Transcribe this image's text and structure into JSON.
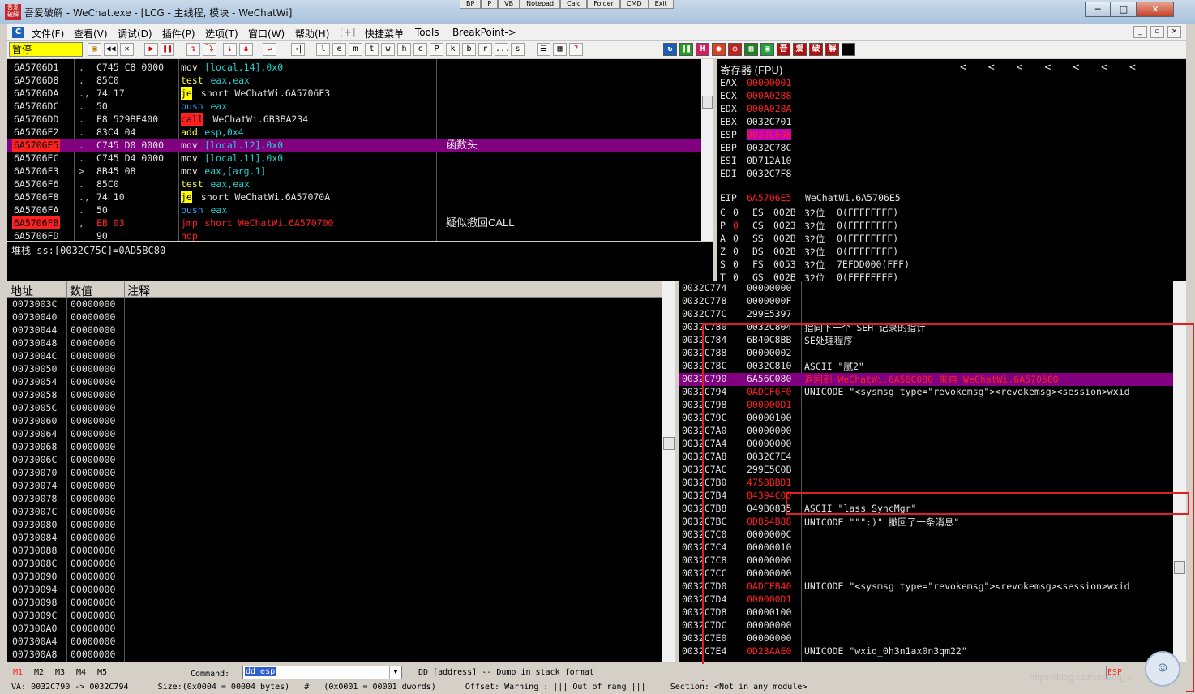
{
  "window": {
    "title": "吾爱破解 - WeChat.exe - [LCG - 主线程, 模块 - WeChatWi]",
    "app_icon_text": "吾爱破解",
    "top_buttons": [
      "BP",
      "P",
      "VB",
      "Notepad",
      "Calc",
      "Folder",
      "CMD",
      "Exit"
    ],
    "controls": {
      "minimize": "─",
      "maximize": "□",
      "close": "✕"
    }
  },
  "menu": {
    "logo": "C",
    "items": [
      "文件(F)",
      "查看(V)",
      "调试(D)",
      "插件(P)",
      "选项(T)",
      "窗口(W)",
      "帮助(H)",
      "[+]",
      "快捷菜单",
      "Tools",
      "BreakPoint->"
    ],
    "mdi": [
      "_",
      "▫",
      "×"
    ]
  },
  "toolbar": {
    "status": "暂停",
    "letters": [
      "l",
      "e",
      "m",
      "t",
      "w",
      "h",
      "c",
      "P",
      "k",
      "b",
      "r",
      "...",
      "s"
    ],
    "plugin_icons": [
      "吾",
      "爱",
      "破",
      "解"
    ]
  },
  "cpu": {
    "rows": [
      {
        "addr": "6A5706D1",
        "mark": ".",
        "hex": "C745 C8 0000",
        "mnem": "mov",
        "ops": "[local.14],0x0",
        "kind": "mov",
        "comment": ""
      },
      {
        "addr": "6A5706D8",
        "mark": ".",
        "hex": "85C0",
        "mnem": "test",
        "ops": "eax,eax",
        "kind": "test",
        "comment": ""
      },
      {
        "addr": "6A5706DA",
        "mark": ".,",
        "hex": "74 17",
        "mnem": "je",
        "ops": "short WeChatWi.6A5706F3",
        "kind": "je",
        "comment": ""
      },
      {
        "addr": "6A5706DC",
        "mark": ".",
        "hex": "50",
        "mnem": "push",
        "ops": "eax",
        "kind": "push",
        "comment": ""
      },
      {
        "addr": "6A5706DD",
        "mark": ".",
        "hex": "E8 529BE400",
        "mnem": "call",
        "ops": "WeChatWi.6B3BA234",
        "kind": "call",
        "comment": ""
      },
      {
        "addr": "6A5706E2",
        "mark": ".",
        "hex": "83C4 04",
        "mnem": "add",
        "ops": "esp,0x4",
        "kind": "add",
        "comment": ""
      },
      {
        "addr": "6A5706E5",
        "mark": ".",
        "hex": "C745 D0 0000",
        "mnem": "mov",
        "ops": "[local.12],0x0",
        "kind": "mov",
        "comment": "函数头",
        "selected": true
      },
      {
        "addr": "6A5706EC",
        "mark": ".",
        "hex": "C745 D4 0000",
        "mnem": "mov",
        "ops": "[local.11],0x0",
        "kind": "mov",
        "comment": ""
      },
      {
        "addr": "6A5706F3",
        "mark": ">",
        "hex": "8B45 08",
        "mnem": "mov",
        "ops": "eax,[arg.1]",
        "kind": "mov2",
        "comment": ""
      },
      {
        "addr": "6A5706F6",
        "mark": ".",
        "hex": "85C0",
        "mnem": "test",
        "ops": "eax,eax",
        "kind": "test",
        "comment": ""
      },
      {
        "addr": "6A5706F8",
        "mark": ".,",
        "hex": "74 10",
        "mnem": "je",
        "ops": "short WeChatWi.6A57070A",
        "kind": "je",
        "comment": ""
      },
      {
        "addr": "6A5706FA",
        "mark": ".",
        "hex": "50",
        "mnem": "push",
        "ops": "eax",
        "kind": "push",
        "comment": ""
      },
      {
        "addr": "6A5706FB",
        "mark": ",",
        "hex": "EB 03",
        "mnem": "jmp",
        "ops": "short WeChatWi.6A570700",
        "kind": "jmp",
        "comment": "疑似撤回CALL",
        "breakpoint": true
      },
      {
        "addr": "6A5706FD",
        "mark": "",
        "hex": "90",
        "mnem": "nop",
        "ops": "",
        "kind": "nop",
        "comment": ""
      }
    ]
  },
  "registers": {
    "header": "寄存器 (FPU)",
    "nav": [
      "<",
      "<",
      "<",
      "<",
      "<",
      "<",
      "<"
    ],
    "regs": [
      {
        "name": "EAX",
        "val": "00000001",
        "red": true
      },
      {
        "name": "ECX",
        "val": "000A0288",
        "red": true
      },
      {
        "name": "EDX",
        "val": "000A028A",
        "red": true
      },
      {
        "name": "EBX",
        "val": "0032C701",
        "red": false
      },
      {
        "name": "ESP",
        "val": "0032C608",
        "red": true,
        "hl": true
      },
      {
        "name": "EBP",
        "val": "0032C78C",
        "red": false
      },
      {
        "name": "ESI",
        "val": "0D712A10",
        "red": false
      },
      {
        "name": "EDI",
        "val": "0032C7F8",
        "red": false
      }
    ],
    "eip": {
      "name": "EIP",
      "val": "6A5706E5",
      "desc": "WeChatWi.6A5706E5"
    },
    "flags": [
      {
        "f": "C",
        "v": "0",
        "seg": "ES",
        "sel": "002B",
        "bits": "32位",
        "base": "0(FFFFFFFF)"
      },
      {
        "f": "P",
        "v": "0",
        "seg": "CS",
        "sel": "0023",
        "bits": "32位",
        "base": "0(FFFFFFFF)",
        "red": true
      },
      {
        "f": "A",
        "v": "0",
        "seg": "SS",
        "sel": "002B",
        "bits": "32位",
        "base": "0(FFFFFFFF)"
      },
      {
        "f": "Z",
        "v": "0",
        "seg": "DS",
        "sel": "002B",
        "bits": "32位",
        "base": "0(FFFFFFFF)"
      },
      {
        "f": "S",
        "v": "0",
        "seg": "FS",
        "sel": "0053",
        "bits": "32位",
        "base": "7EFDD000(FFF)"
      },
      {
        "f": "T",
        "v": "0",
        "seg": "GS",
        "sel": "002B",
        "bits": "32位",
        "base": "0(FFFFFFFF)"
      }
    ]
  },
  "info": {
    "line": "堆栈 ss:[0032C75C]=0AD5BC80"
  },
  "dump": {
    "headers": [
      "地址",
      "数值",
      "注释"
    ],
    "rows": [
      [
        "0073003C",
        "00000000"
      ],
      [
        "00730040",
        "00000000"
      ],
      [
        "00730044",
        "00000000"
      ],
      [
        "00730048",
        "00000000"
      ],
      [
        "0073004C",
        "00000000"
      ],
      [
        "00730050",
        "00000000"
      ],
      [
        "00730054",
        "00000000"
      ],
      [
        "00730058",
        "00000000"
      ],
      [
        "0073005C",
        "00000000"
      ],
      [
        "00730060",
        "00000000"
      ],
      [
        "00730064",
        "00000000"
      ],
      [
        "00730068",
        "00000000"
      ],
      [
        "0073006C",
        "00000000"
      ],
      [
        "00730070",
        "00000000"
      ],
      [
        "00730074",
        "00000000"
      ],
      [
        "00730078",
        "00000000"
      ],
      [
        "0073007C",
        "00000000"
      ],
      [
        "00730080",
        "00000000"
      ],
      [
        "00730084",
        "00000000"
      ],
      [
        "00730088",
        "00000000"
      ],
      [
        "0073008C",
        "00000000"
      ],
      [
        "00730090",
        "00000000"
      ],
      [
        "00730094",
        "00000000"
      ],
      [
        "00730098",
        "00000000"
      ],
      [
        "0073009C",
        "00000000"
      ],
      [
        "007300A0",
        "00000000"
      ],
      [
        "007300A4",
        "00000000"
      ],
      [
        "007300A8",
        "00000000"
      ]
    ]
  },
  "stack": {
    "rows": [
      {
        "addr": "0032C774",
        "val": "00000000",
        "c": ""
      },
      {
        "addr": "0032C778",
        "val": "0000000F",
        "c": ""
      },
      {
        "addr": "0032C77C",
        "val": "299E5397",
        "c": ""
      },
      {
        "addr": "0032C780",
        "val": "0032C804",
        "c": "指向下一个 SEH 记录的指针"
      },
      {
        "addr": "0032C784",
        "val": "6B40C8BB",
        "c": "SE处理程序"
      },
      {
        "addr": "0032C788",
        "val": "00000002",
        "c": ""
      },
      {
        "addr": "0032C78C",
        "val": "0032C810",
        "c": "ASCII \"腻2\""
      },
      {
        "addr": "0032C790",
        "val": "6A56C080",
        "c": "返回到 WeChatWi.6A56C080 来自 WeChatWi.6A570580",
        "hl": true
      },
      {
        "addr": "0032C794",
        "val": "0ADCF6F0",
        "c": "UNICODE \"<sysmsg type=\"revokemsg\"><revokemsg><session>wxid",
        "red": true
      },
      {
        "addr": "0032C798",
        "val": "000000D1",
        "c": "",
        "red": true
      },
      {
        "addr": "0032C79C",
        "val": "00000100",
        "c": ""
      },
      {
        "addr": "0032C7A0",
        "val": "00000000",
        "c": ""
      },
      {
        "addr": "0032C7A4",
        "val": "00000000",
        "c": ""
      },
      {
        "addr": "0032C7A8",
        "val": "0032C7E4",
        "c": ""
      },
      {
        "addr": "0032C7AC",
        "val": "299E5C0B",
        "c": ""
      },
      {
        "addr": "0032C7B0",
        "val": "4758BBD1",
        "c": "",
        "red": true
      },
      {
        "addr": "0032C7B4",
        "val": "84394C00",
        "c": "",
        "red": true
      },
      {
        "addr": "0032C7B8",
        "val": "049B0835",
        "c": "ASCII \"lass SyncMgr\""
      },
      {
        "addr": "0032C7BC",
        "val": "0D854B88",
        "c": "UNICODE \"\"\":)\" 撤回了一条消息\"",
        "red": true
      },
      {
        "addr": "0032C7C0",
        "val": "0000000C",
        "c": ""
      },
      {
        "addr": "0032C7C4",
        "val": "00000010",
        "c": ""
      },
      {
        "addr": "0032C7C8",
        "val": "00000000",
        "c": ""
      },
      {
        "addr": "0032C7CC",
        "val": "00000000",
        "c": ""
      },
      {
        "addr": "0032C7D0",
        "val": "0ADCFB40",
        "c": "UNICODE \"<sysmsg type=\"revokemsg\"><revokemsg><session>wxid",
        "red": true
      },
      {
        "addr": "0032C7D4",
        "val": "000000D1",
        "c": "",
        "red": true
      },
      {
        "addr": "0032C7D8",
        "val": "00000100",
        "c": ""
      },
      {
        "addr": "0032C7DC",
        "val": "00000000",
        "c": ""
      },
      {
        "addr": "0032C7E0",
        "val": "00000000",
        "c": ""
      },
      {
        "addr": "0032C7E4",
        "val": "0D23AAE0",
        "c": "UNICODE \"wxid_0h3n1ax0n3qm22\"",
        "red": true
      }
    ]
  },
  "cmdbar": {
    "tabs": [
      "M1",
      "M2",
      "M3",
      "M4",
      "M5"
    ],
    "command_label": "Command:",
    "command_value": "dd esp",
    "hint": "DD [address] -- Dump in stack format",
    "esp_label": "ESP"
  },
  "status": {
    "line": "VA: 0032C790 -> 0032C794      Size:(0x0004 = 00004 bytes)   #   (0x0001 = 00001 dwords)      Offset: Warning : ||| Out of rang |||     Section: <Not in any module>"
  },
  "watermark": "https://blog.csdn.net/qq_..."
}
